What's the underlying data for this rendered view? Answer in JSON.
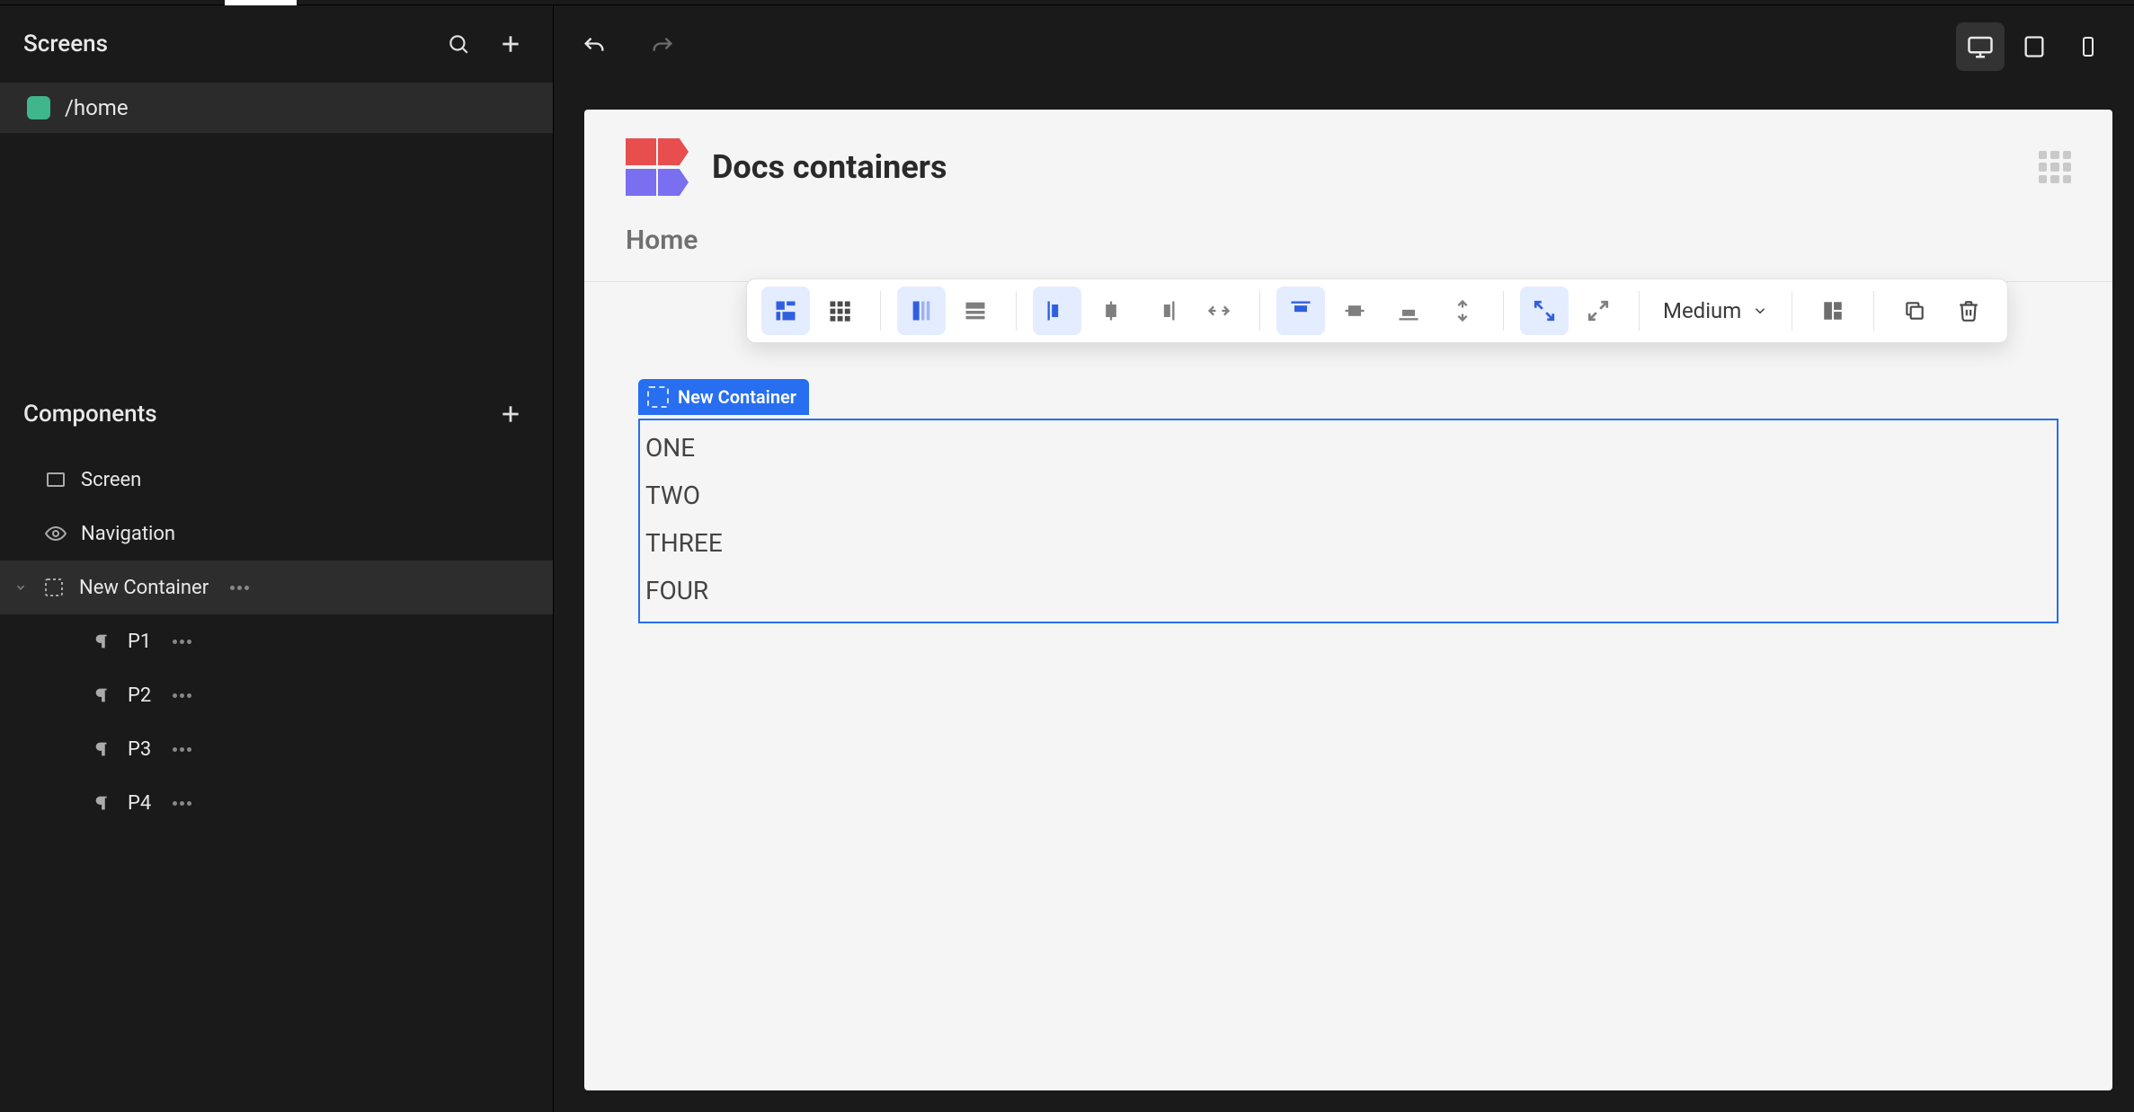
{
  "sidebar": {
    "screens_label": "Screens",
    "screen_items": [
      {
        "label": "/home"
      }
    ],
    "components_label": "Components",
    "tree": {
      "screen": "Screen",
      "navigation": "Navigation",
      "container": "New Container",
      "children": [
        {
          "label": "P1"
        },
        {
          "label": "P2"
        },
        {
          "label": "P3"
        },
        {
          "label": "P4"
        }
      ]
    }
  },
  "canvas": {
    "app_title": "Docs containers",
    "breadcrumb": "Home",
    "selection_label": "New Container",
    "paragraphs": [
      "ONE",
      "TWO",
      "THREE",
      "FOUR"
    ]
  },
  "float_toolbar": {
    "size_label": "Medium"
  },
  "icons": {
    "search": "search-icon",
    "plus": "plus-icon",
    "undo": "undo-icon",
    "redo": "redo-icon",
    "desktop": "desktop-icon",
    "tablet": "tablet-icon",
    "mobile": "mobile-icon"
  }
}
